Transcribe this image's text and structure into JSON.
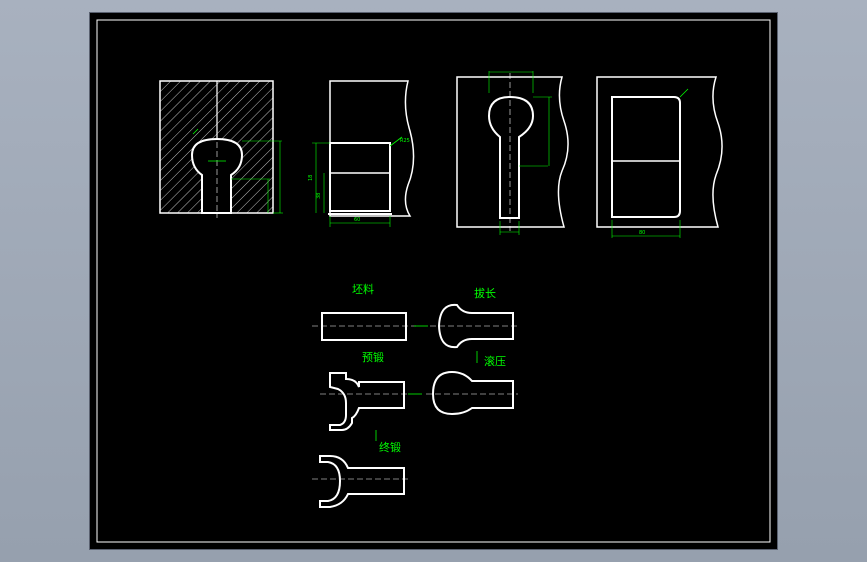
{
  "colors": {
    "background": "#000000",
    "outline": "#ffffff",
    "dimension": "#00ff00",
    "hatch": "#bfbfbf",
    "window_bg": "#9aa4b3"
  },
  "process_steps": {
    "blank": "坯料",
    "draw_out": "拔长",
    "pre_forge": "预锻",
    "roll_press": "滚压",
    "final_forge": "终锻"
  },
  "dimension_texts": [
    "R25",
    "18",
    "38",
    "60",
    "80"
  ]
}
